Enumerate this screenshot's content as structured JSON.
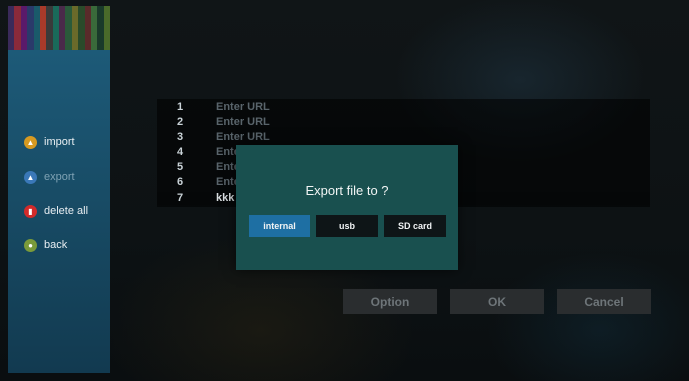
{
  "sidebar": {
    "items": [
      {
        "label": "import",
        "icon": "import-icon",
        "color": "#d69a22"
      },
      {
        "label": "export",
        "icon": "export-icon",
        "color": "#3a78b8"
      },
      {
        "label": "delete all",
        "icon": "trash-icon",
        "color": "#d22b2b"
      },
      {
        "label": "back",
        "icon": "back-icon",
        "color": "#7a9a3a"
      }
    ]
  },
  "url_list": {
    "rows": [
      {
        "num": "1",
        "text": "Enter URL"
      },
      {
        "num": "2",
        "text": "Enter URL"
      },
      {
        "num": "3",
        "text": "Enter URL"
      },
      {
        "num": "4",
        "text": "Ente"
      },
      {
        "num": "5",
        "text": "Ente"
      },
      {
        "num": "6",
        "text": "Ente"
      },
      {
        "num": "7",
        "text": "kkk"
      }
    ]
  },
  "buttons": {
    "option": "Option",
    "ok": "OK",
    "cancel": "Cancel"
  },
  "dialog": {
    "title": "Export file to ?",
    "options": [
      {
        "label": "internal",
        "selected": true
      },
      {
        "label": "usb",
        "selected": false
      },
      {
        "label": "SD card",
        "selected": false
      }
    ]
  },
  "colors": {
    "accent": "#1e6fa3",
    "dialog_bg": "#19504f",
    "sidebar_bg": "#1d5a78"
  }
}
